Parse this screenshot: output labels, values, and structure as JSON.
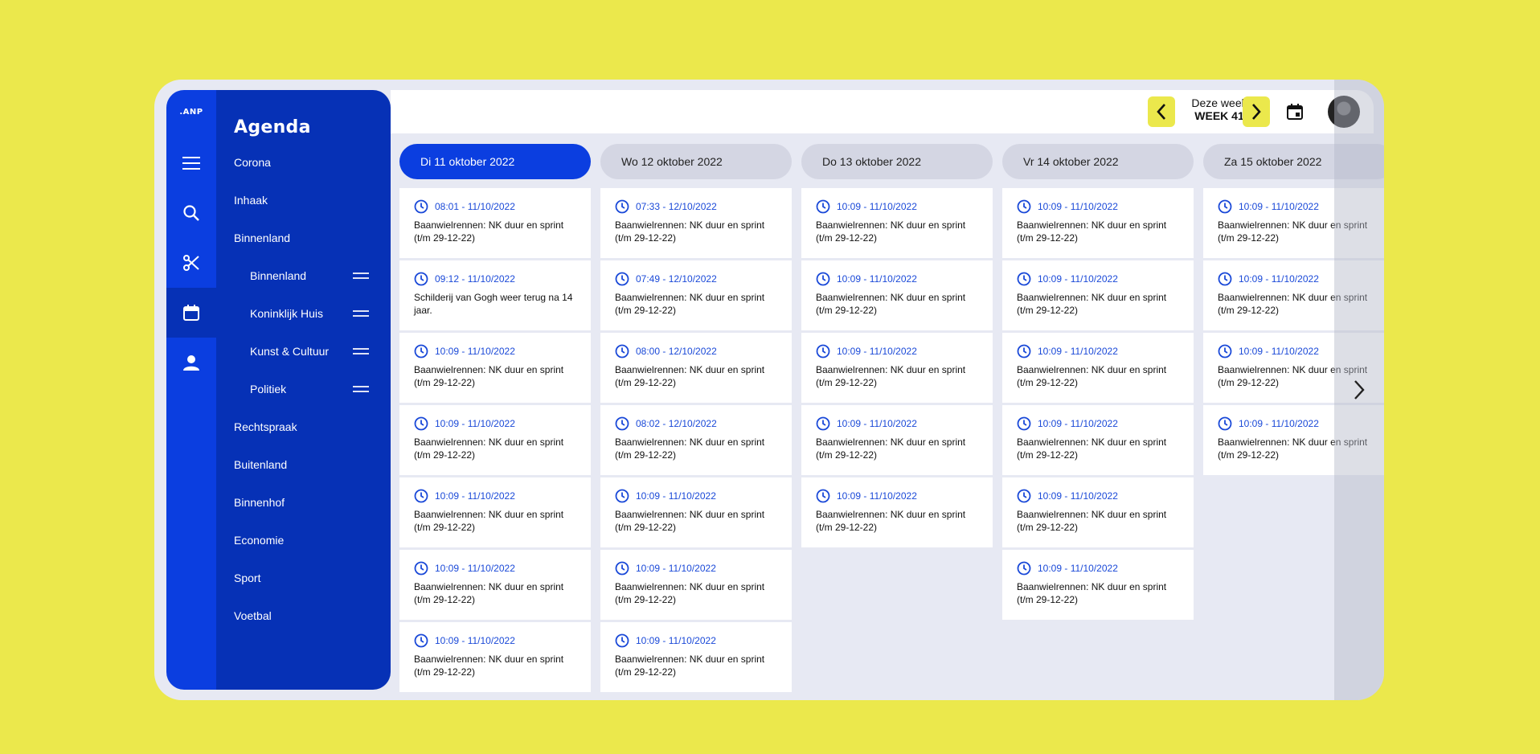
{
  "app": {
    "logo": ".ANP"
  },
  "menu": {
    "title": "Agenda",
    "items": [
      {
        "label": "Corona",
        "sub": false
      },
      {
        "label": "Inhaak",
        "sub": false
      },
      {
        "label": "Binnenland",
        "sub": false
      },
      {
        "label": "Binnenland",
        "sub": true
      },
      {
        "label": "Koninklijk Huis",
        "sub": true
      },
      {
        "label": "Kunst & Cultuur",
        "sub": true
      },
      {
        "label": "Politiek",
        "sub": true
      },
      {
        "label": "Rechtspraak",
        "sub": false
      },
      {
        "label": "Buitenland",
        "sub": false
      },
      {
        "label": "Binnenhof",
        "sub": false
      },
      {
        "label": "Economie",
        "sub": false
      },
      {
        "label": "Sport",
        "sub": false
      },
      {
        "label": "Voetbal",
        "sub": false
      }
    ]
  },
  "rail": {
    "icons": [
      "menu-icon",
      "search-icon",
      "scissors-icon",
      "calendar-icon",
      "user-icon"
    ],
    "active": "calendar-icon"
  },
  "header": {
    "week_label": "Deze week",
    "week_number": "WEEK 41"
  },
  "colors": {
    "accent": "#0b3ee0",
    "accent_dark": "#0631b6",
    "highlight": "#ebe84c",
    "background": "#e7e9f3"
  },
  "days": [
    {
      "label": "Di 11 oktober 2022",
      "active": true,
      "events": [
        {
          "time": "08:01 - 11/10/2022",
          "title": "Baanwielrennen: NK duur en sprint (t/m 29-12-22)"
        },
        {
          "time": "09:12 - 11/10/2022",
          "title": "Schilderij van Gogh weer terug na 14 jaar."
        },
        {
          "time": "10:09 - 11/10/2022",
          "title": "Baanwielrennen: NK duur en sprint (t/m 29-12-22)"
        },
        {
          "time": "10:09 - 11/10/2022",
          "title": "Baanwielrennen: NK duur en sprint (t/m 29-12-22)"
        },
        {
          "time": "10:09 - 11/10/2022",
          "title": "Baanwielrennen: NK duur en sprint (t/m 29-12-22)"
        },
        {
          "time": "10:09 - 11/10/2022",
          "title": "Baanwielrennen: NK duur en sprint (t/m 29-12-22)"
        },
        {
          "time": "10:09 - 11/10/2022",
          "title": "Baanwielrennen: NK duur en sprint (t/m 29-12-22)"
        }
      ]
    },
    {
      "label": "Wo 12 oktober 2022",
      "active": false,
      "events": [
        {
          "time": "07:33 - 12/10/2022",
          "title": "Baanwielrennen: NK duur en sprint (t/m 29-12-22)"
        },
        {
          "time": "07:49 - 12/10/2022",
          "title": "Baanwielrennen: NK duur en sprint (t/m 29-12-22)"
        },
        {
          "time": "08:00 - 12/10/2022",
          "title": "Baanwielrennen: NK duur en sprint (t/m 29-12-22)"
        },
        {
          "time": "08:02 - 12/10/2022",
          "title": "Baanwielrennen: NK duur en sprint (t/m 29-12-22)"
        },
        {
          "time": "10:09 - 11/10/2022",
          "title": "Baanwielrennen: NK duur en sprint (t/m 29-12-22)"
        },
        {
          "time": "10:09 - 11/10/2022",
          "title": "Baanwielrennen: NK duur en sprint (t/m 29-12-22)"
        },
        {
          "time": "10:09 - 11/10/2022",
          "title": "Baanwielrennen: NK duur en sprint (t/m 29-12-22)"
        }
      ]
    },
    {
      "label": "Do 13 oktober 2022",
      "active": false,
      "events": [
        {
          "time": "10:09 - 11/10/2022",
          "title": "Baanwielrennen: NK duur en sprint (t/m 29-12-22)"
        },
        {
          "time": "10:09 - 11/10/2022",
          "title": "Baanwielrennen: NK duur en sprint (t/m 29-12-22)"
        },
        {
          "time": "10:09 - 11/10/2022",
          "title": "Baanwielrennen: NK duur en sprint (t/m 29-12-22)"
        },
        {
          "time": "10:09 - 11/10/2022",
          "title": "Baanwielrennen: NK duur en sprint (t/m 29-12-22)"
        },
        {
          "time": "10:09 - 11/10/2022",
          "title": "Baanwielrennen: NK duur en sprint (t/m 29-12-22)"
        }
      ]
    },
    {
      "label": "Vr 14 oktober 2022",
      "active": false,
      "events": [
        {
          "time": "10:09 - 11/10/2022",
          "title": "Baanwielrennen: NK duur en sprint (t/m 29-12-22)"
        },
        {
          "time": "10:09 - 11/10/2022",
          "title": "Baanwielrennen: NK duur en sprint (t/m 29-12-22)"
        },
        {
          "time": "10:09 - 11/10/2022",
          "title": "Baanwielrennen: NK duur en sprint (t/m 29-12-22)"
        },
        {
          "time": "10:09 - 11/10/2022",
          "title": "Baanwielrennen: NK duur en sprint (t/m 29-12-22)"
        },
        {
          "time": "10:09 - 11/10/2022",
          "title": "Baanwielrennen: NK duur en sprint (t/m 29-12-22)"
        },
        {
          "time": "10:09 - 11/10/2022",
          "title": "Baanwielrennen: NK duur en sprint (t/m 29-12-22)"
        }
      ]
    },
    {
      "label": "Za 15 oktober 2022",
      "active": false,
      "events": [
        {
          "time": "10:09 - 11/10/2022",
          "title": "Baanwielrennen: NK duur en sprint (t/m 29-12-22)"
        },
        {
          "time": "10:09 - 11/10/2022",
          "title": "Baanwielrennen: NK duur en sprint (t/m 29-12-22)"
        },
        {
          "time": "10:09 - 11/10/2022",
          "title": "Baanwielrennen: NK duur en sprint (t/m 29-12-22)"
        },
        {
          "time": "10:09 - 11/10/2022",
          "title": "Baanwielrennen: NK duur en sprint (t/m 29-12-22)"
        }
      ]
    }
  ]
}
